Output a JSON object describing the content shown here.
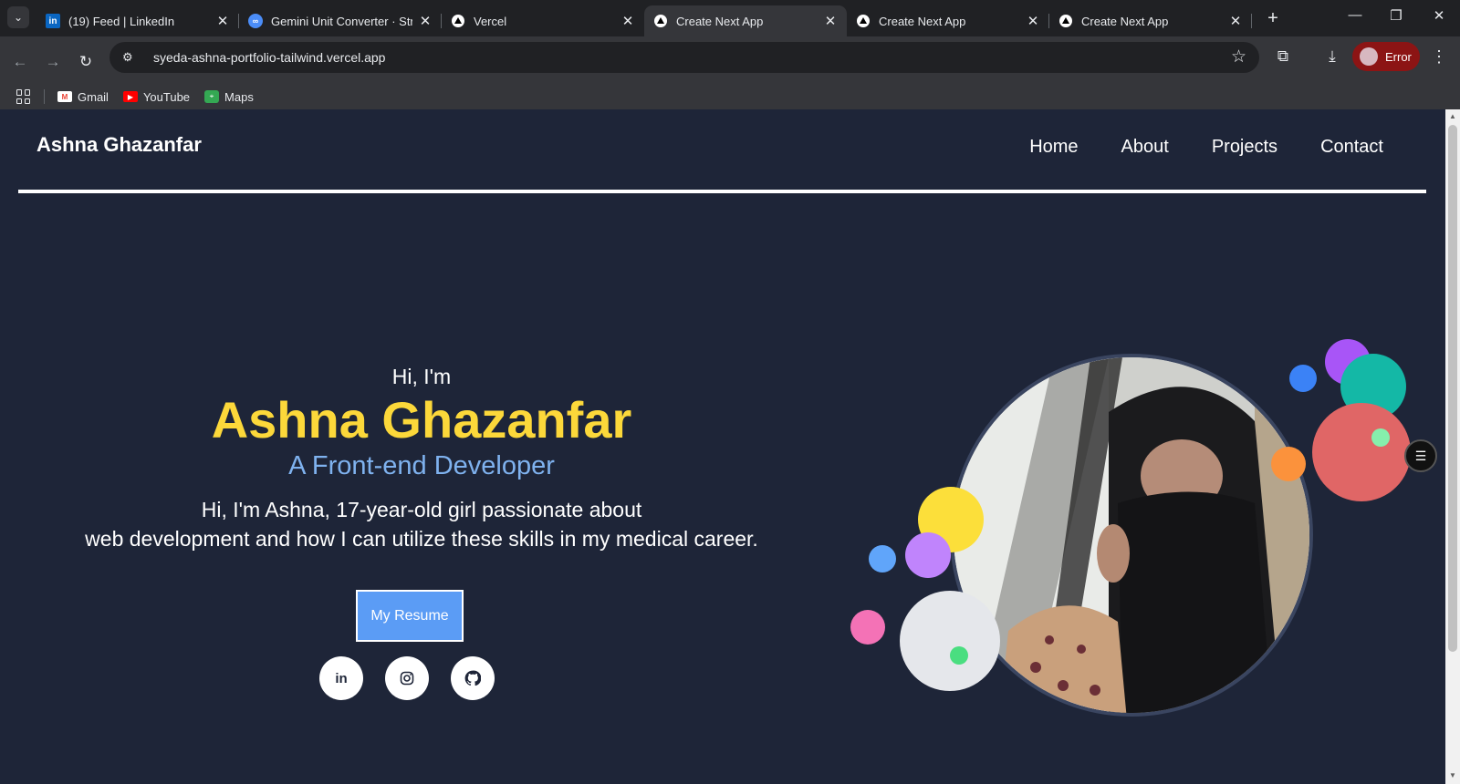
{
  "browser": {
    "tabs": [
      {
        "title": "(19) Feed | LinkedIn",
        "favicon": "linkedin-icon"
      },
      {
        "title": "Gemini Unit Converter · Strea",
        "favicon": "streamlit-icon"
      },
      {
        "title": "Vercel",
        "favicon": "vercel-icon"
      },
      {
        "title": "Create Next App",
        "favicon": "vercel-icon",
        "active": true
      },
      {
        "title": "Create Next App",
        "favicon": "vercel-icon"
      },
      {
        "title": "Create Next App",
        "favicon": "vercel-icon"
      }
    ],
    "url": "syeda-ashna-portfolio-tailwind.vercel.app",
    "profile_label": "Error",
    "bookmarks": [
      {
        "label": "Gmail",
        "icon": "gmail-icon"
      },
      {
        "label": "YouTube",
        "icon": "youtube-icon"
      },
      {
        "label": "Maps",
        "icon": "maps-icon"
      }
    ]
  },
  "site": {
    "brand": "Ashna Ghazanfar",
    "nav": [
      "Home",
      "About",
      "Projects",
      "Contact"
    ],
    "hero": {
      "greeting": "Hi, I'm",
      "name": "Ashna Ghazanfar",
      "role": "A Front-end Developer",
      "bio_line1": "Hi, I'm Ashna, 17-year-old girl passionate about",
      "bio_line2": "web development and how I can utilize these skills in my medical career.",
      "resume_label": "My Resume"
    },
    "social": [
      {
        "name": "linkedin",
        "glyph": "in"
      },
      {
        "name": "instagram",
        "glyph": "instagram-icon"
      },
      {
        "name": "github",
        "glyph": "github-icon"
      }
    ]
  },
  "colors": {
    "background": "#1e2538",
    "name_accent": "#fcd83a",
    "role_accent": "#7fb2ef",
    "button": "#5b9cf5"
  }
}
